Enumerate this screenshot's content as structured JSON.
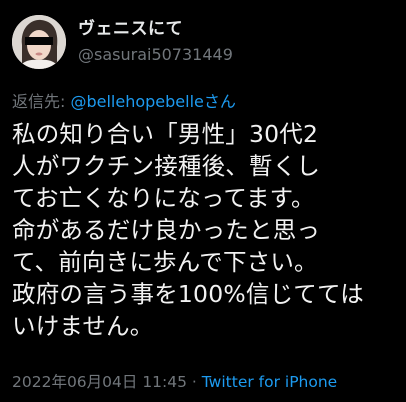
{
  "author": {
    "display_name": "ヴェニスにて",
    "handle": "@sasurai50731449",
    "avatar_icon": "profile-photo-icon"
  },
  "reply": {
    "prefix": "返信先: ",
    "mention": "@bellehopebelle",
    "suffix": "さん"
  },
  "body": {
    "lines": [
      "私の知り合い「男性」30代2",
      "人がワクチン接種後、暫くし",
      "てお亡くなりになってます。",
      "命があるだけ良かったと思っ",
      "て、前向きに歩んで下さい。",
      "政府の言う事を100%信じてては",
      "いけません。"
    ]
  },
  "meta": {
    "timestamp": "2022年06月04日 11:45",
    "separator": " · ",
    "source": "Twitter for iPhone"
  },
  "colors": {
    "background": "#000000",
    "text": "#e7e9ea",
    "secondary": "#71767b",
    "link": "#1d9bf0"
  }
}
